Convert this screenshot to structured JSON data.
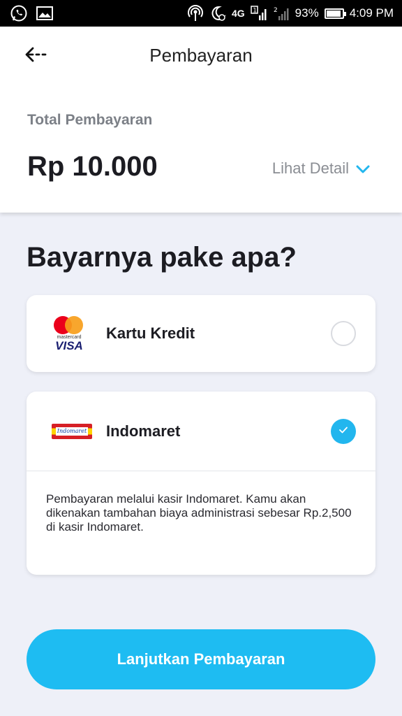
{
  "status_bar": {
    "network": "4G",
    "sim1": "1",
    "sim2": "2",
    "battery": "93%",
    "time": "4:09 PM"
  },
  "header": {
    "title": "Pembayaran",
    "total_label": "Total Pembayaran",
    "total_amount": "Rp 10.000",
    "detail_link": "Lihat Detail"
  },
  "question": "Bayarnya pake apa?",
  "payment_methods": [
    {
      "label": "Kartu Kredit",
      "logo_text_top": "mastercard",
      "logo_text_bottom": "VISA",
      "selected": false
    },
    {
      "label": "Indomaret",
      "logo_text": "Indomaret",
      "selected": true,
      "description": "Pembayaran melalui kasir Indomaret. Kamu akan dikenakan tambahan biaya administrasi sebesar Rp.2,500 di kasir Indomaret."
    }
  ],
  "cta_label": "Lanjutkan Pembayaran",
  "colors": {
    "accent": "#1ebcf2",
    "background": "#eef0f8"
  }
}
